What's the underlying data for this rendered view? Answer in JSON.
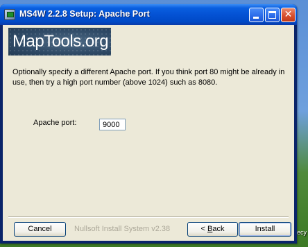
{
  "window": {
    "title": "MS4W 2.2.8 Setup: Apache Port",
    "controls": {
      "minimize": "minimize-icon",
      "maximize": "maximize-icon",
      "close": "close-icon"
    }
  },
  "banner": {
    "text": "MapTools.org"
  },
  "description": "Optionally specify a different Apache port.  If you think port 80 might be already in use, then try a high port number (above 1024) such as 8080.",
  "port": {
    "label": "Apache port:",
    "value": "9000"
  },
  "footer": {
    "cancel_label": "Cancel",
    "branding": "Nullsoft Install System v2.38",
    "back_prefix": "< ",
    "back_label_underlined": "B",
    "back_label_rest": "ack",
    "install_label": "Install"
  },
  "desktop": {
    "label": "Recy"
  },
  "colors": {
    "titlebar": "#0452d4",
    "client_bg": "#ece9d8",
    "close_button": "#d8502e"
  }
}
